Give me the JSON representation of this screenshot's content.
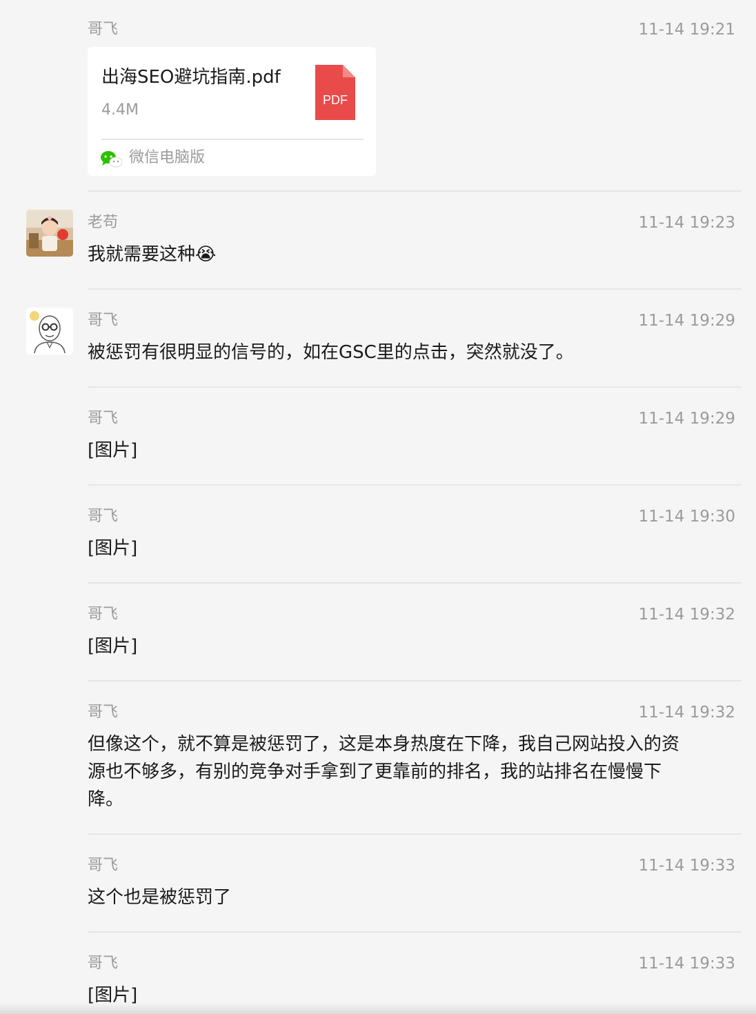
{
  "messages": [
    {
      "sender": "哥飞",
      "time": "11-14 19:21",
      "file": {
        "name": "出海SEO避坑指南.pdf",
        "size": "4.4M",
        "type_label": "PDF",
        "source": "微信电脑版"
      }
    },
    {
      "sender": "老苟",
      "time": "11-14 19:23",
      "text": "我就需要这种😭"
    },
    {
      "sender": "哥飞",
      "time": "11-14 19:29",
      "text": "被惩罚有很明显的信号的，如在GSC里的点击，突然就没了。"
    },
    {
      "sender": "哥飞",
      "time": "11-14 19:29",
      "text": "[图片]"
    },
    {
      "sender": "哥飞",
      "time": "11-14 19:30",
      "text": "[图片]"
    },
    {
      "sender": "哥飞",
      "time": "11-14 19:32",
      "text": "[图片]"
    },
    {
      "sender": "哥飞",
      "time": "11-14 19:32",
      "text_lines": [
        "但像这个，就不算是被惩罚了，这是本身热度在下降，我自己网站投入的资",
        "源也不够多，有别的竞争对手拿到了更靠前的排名，我的站排名在慢慢下",
        "降。"
      ]
    },
    {
      "sender": "哥飞",
      "time": "11-14 19:33",
      "text": "这个也是被惩罚了"
    },
    {
      "sender": "哥飞",
      "time": "11-14 19:33",
      "text": "[图片]"
    }
  ],
  "colors": {
    "pdf_red": "#e94b4b",
    "wechat_green": "#2dc100",
    "meta_gray": "#9b9b9b",
    "background": "#f5f5f5"
  }
}
